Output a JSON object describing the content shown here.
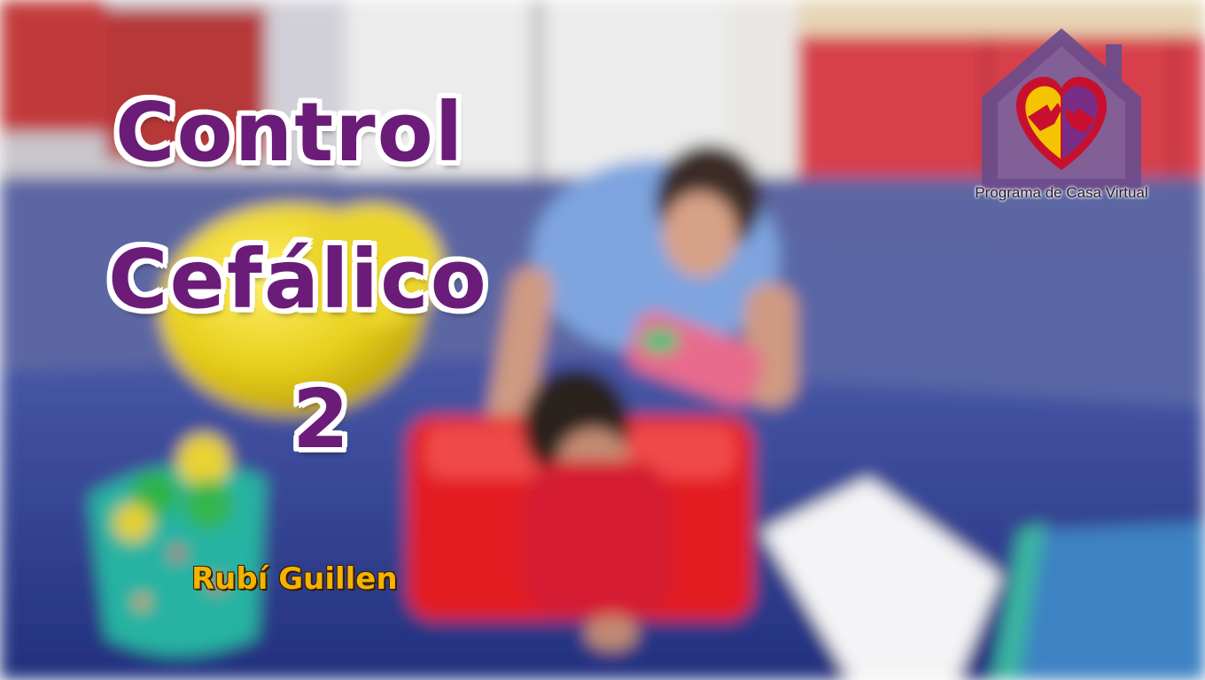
{
  "title": {
    "line1": "Control",
    "line2": "Cefálico",
    "line3": "2"
  },
  "author": "Rubí Guillen",
  "logo": {
    "caption": "Programa de Casa Virtual",
    "icon": "house-heart-hands-icon"
  },
  "colors": {
    "title": "#6b1c78",
    "title_outline": "#ffffff",
    "author": "#f2b400",
    "logo_house": "#6a4c8c",
    "heart_yellow": "#f5c400",
    "heart_purple": "#7a2d86",
    "heart_red": "#c8102e"
  }
}
